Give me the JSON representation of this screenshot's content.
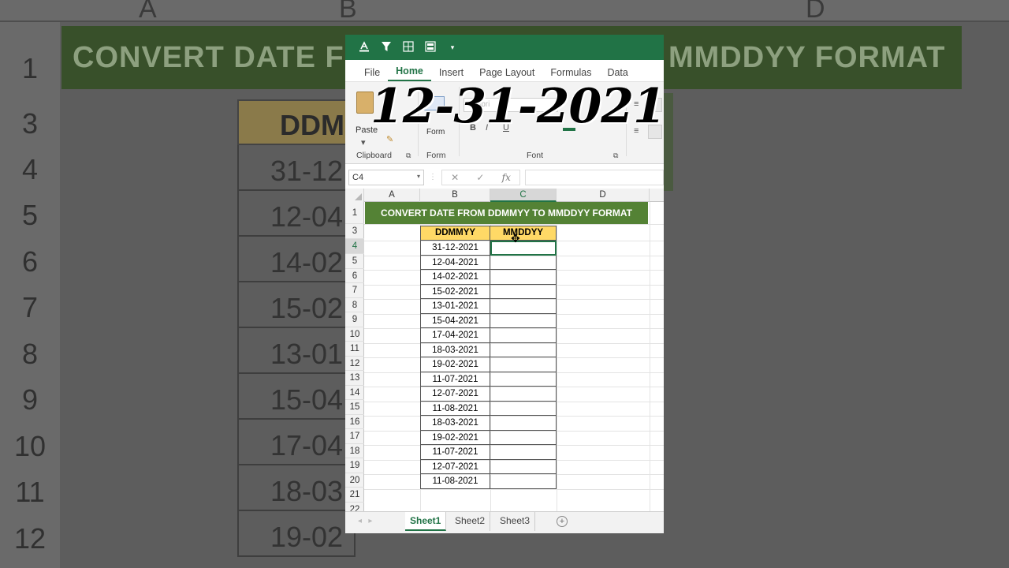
{
  "background": {
    "col_letters": [
      "A",
      "B",
      "D"
    ],
    "row_numbers": [
      "1",
      "3",
      "4",
      "5",
      "6",
      "7",
      "8",
      "9",
      "10",
      "11",
      "12"
    ],
    "title_left": "CONVERT DATE F",
    "title_right": "MMDDYY FORMAT",
    "header_text": "DDM",
    "cells": [
      "31-12",
      "12-04",
      "14-02",
      "15-02",
      "13-01",
      "15-04",
      "17-04",
      "18-03",
      "19-02"
    ]
  },
  "overlay": {
    "date_text": "12-31-2021"
  },
  "quick_access": {
    "icons": [
      "text-color-icon",
      "filter-icon",
      "borders-icon",
      "freeze-panes-icon",
      "qat-dropdown-icon"
    ]
  },
  "ribbon_tabs": [
    "File",
    "Home",
    "Insert",
    "Page Layout",
    "Formulas",
    "Data"
  ],
  "active_tab": "Home",
  "ribbon": {
    "paste_label": "Paste",
    "format_label": "Form",
    "font_name": "Calibri",
    "groups": [
      "Clipboard",
      "Form",
      "Font"
    ]
  },
  "formula_bar": {
    "name_box": "C4",
    "cancel": "✕",
    "enter": "✓",
    "fx": "fx",
    "value": ""
  },
  "grid": {
    "columns": [
      "A",
      "B",
      "C",
      "D"
    ],
    "selected_column": "C",
    "title": "CONVERT DATE FROM DDMMYY TO MMDDYY FORMAT",
    "headers": {
      "b": "DDMMYY",
      "c": "MMDDYY"
    },
    "rows": [
      "1",
      "3",
      "4",
      "5",
      "6",
      "7",
      "8",
      "9",
      "10",
      "11",
      "12",
      "13",
      "14",
      "15",
      "16",
      "17",
      "18",
      "19",
      "20",
      "21",
      "22"
    ],
    "selected_row": "4",
    "dates": [
      "31-12-2021",
      "12-04-2021",
      "14-02-2021",
      "15-02-2021",
      "13-01-2021",
      "15-04-2021",
      "17-04-2021",
      "18-03-2021",
      "19-02-2021",
      "11-07-2021",
      "12-07-2021",
      "11-08-2021",
      "18-03-2021",
      "19-02-2021",
      "11-07-2021",
      "12-07-2021",
      "11-08-2021"
    ],
    "active_cell": "C4"
  },
  "sheets": [
    "Sheet1",
    "Sheet2",
    "Sheet3"
  ],
  "active_sheet": "Sheet1",
  "colors": {
    "excel_green": "#217346",
    "title_fill": "#548235",
    "header_fill": "#ffd966"
  }
}
